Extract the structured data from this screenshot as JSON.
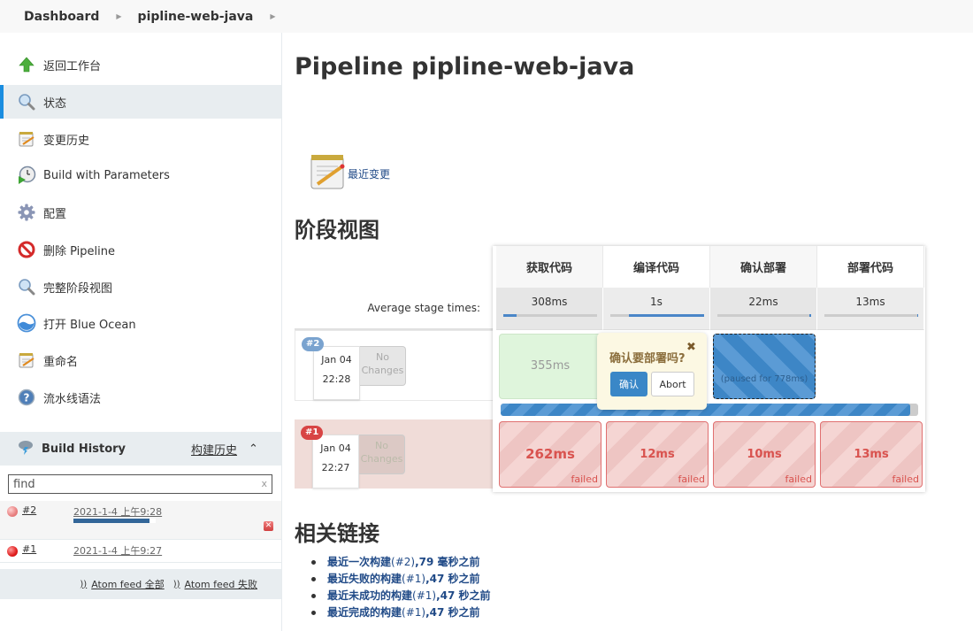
{
  "breadcrumb": [
    {
      "label": "Dashboard"
    },
    {
      "label": "pipline-web-java"
    }
  ],
  "sidebar": {
    "items": [
      {
        "label": "返回工作台",
        "icon": "up-arrow-icon",
        "active": false
      },
      {
        "label": "状态",
        "icon": "magnifier-icon",
        "active": true
      },
      {
        "label": "变更历史",
        "icon": "notepad-icon",
        "active": false
      },
      {
        "label": "Build with Parameters",
        "icon": "clock-play-icon",
        "active": false
      },
      {
        "label": "配置",
        "icon": "gear-icon",
        "active": false
      },
      {
        "label": "删除 Pipeline",
        "icon": "no-entry-icon",
        "active": false
      },
      {
        "label": "完整阶段视图",
        "icon": "magnifier-icon",
        "active": false
      },
      {
        "label": "打开 Blue Ocean",
        "icon": "blue-ocean-icon",
        "active": false
      },
      {
        "label": "重命名",
        "icon": "notepad-icon",
        "active": false
      },
      {
        "label": "流水线语法",
        "icon": "help-icon",
        "active": false
      }
    ]
  },
  "build_history": {
    "title": "Build History",
    "trend_link": "构建历史",
    "search_placeholder": "find",
    "search_clear": "x",
    "builds": [
      {
        "number": "#2",
        "date": "2021-1-4 上午9:28",
        "status": "running",
        "progress": 0.93
      },
      {
        "number": "#1",
        "date": "2021-1-4 上午9:27",
        "status": "failed"
      }
    ],
    "atom_all": "Atom feed 全部",
    "atom_failed": "Atom feed 失败"
  },
  "main": {
    "title": "Pipeline pipline-web-java",
    "recent_changes": "最近变更",
    "stage_view_heading": "阶段视图",
    "related_links_heading": "相关链接"
  },
  "stage_view": {
    "avg_label": "Average stage times:",
    "stages": [
      {
        "name": "获取代码",
        "avg": "308ms",
        "avg_fraction": 0.14
      },
      {
        "name": "编译代码",
        "avg": "1s",
        "avg_fraction": 1.0
      },
      {
        "name": "确认部署",
        "avg": "22ms",
        "avg_fraction": 0.02
      },
      {
        "name": "部署代码",
        "avg": "13ms",
        "avg_fraction": 0.01
      }
    ],
    "runs": [
      {
        "badge": "#2",
        "date": "Jan 04",
        "time": "22:28",
        "changes": "No Changes",
        "cells": [
          {
            "status": "success",
            "text": "355ms"
          },
          {
            "status": "running",
            "text": ""
          },
          {
            "status": "paused",
            "text": "(paused for 778ms)"
          },
          {
            "status": "empty",
            "text": ""
          }
        ],
        "progress": 0.98
      },
      {
        "badge": "#1",
        "date": "Jan 04",
        "time": "22:27",
        "changes": "No Changes",
        "cells": [
          {
            "status": "failed",
            "text": "262ms",
            "note": "failed"
          },
          {
            "status": "failed",
            "text": "12ms",
            "note": "failed"
          },
          {
            "status": "failed",
            "text": "10ms",
            "note": "failed"
          },
          {
            "status": "failed",
            "text": "13ms",
            "note": "failed"
          }
        ]
      }
    ],
    "input_prompt": {
      "message": "确认要部署吗?",
      "proceed": "确认",
      "abort": "Abort",
      "close": "✖"
    }
  },
  "related_links": [
    {
      "text": "最近一次构建",
      "num": "(#2)",
      "tail": ",79 毫秒之前"
    },
    {
      "text": "最近失败的构建",
      "num": "(#1)",
      "tail": ",47 秒之前"
    },
    {
      "text": "最近未成功的构建",
      "num": "(#1)",
      "tail": ",47 秒之前"
    },
    {
      "text": "最近完成的构建",
      "num": "(#1)",
      "tail": ",47 秒之前"
    }
  ],
  "colors": {
    "accent": "#1a8de0",
    "link": "#204a87",
    "success_bg": "#dff5dc",
    "failed": "#d9534f",
    "running": "#3d86c6"
  }
}
